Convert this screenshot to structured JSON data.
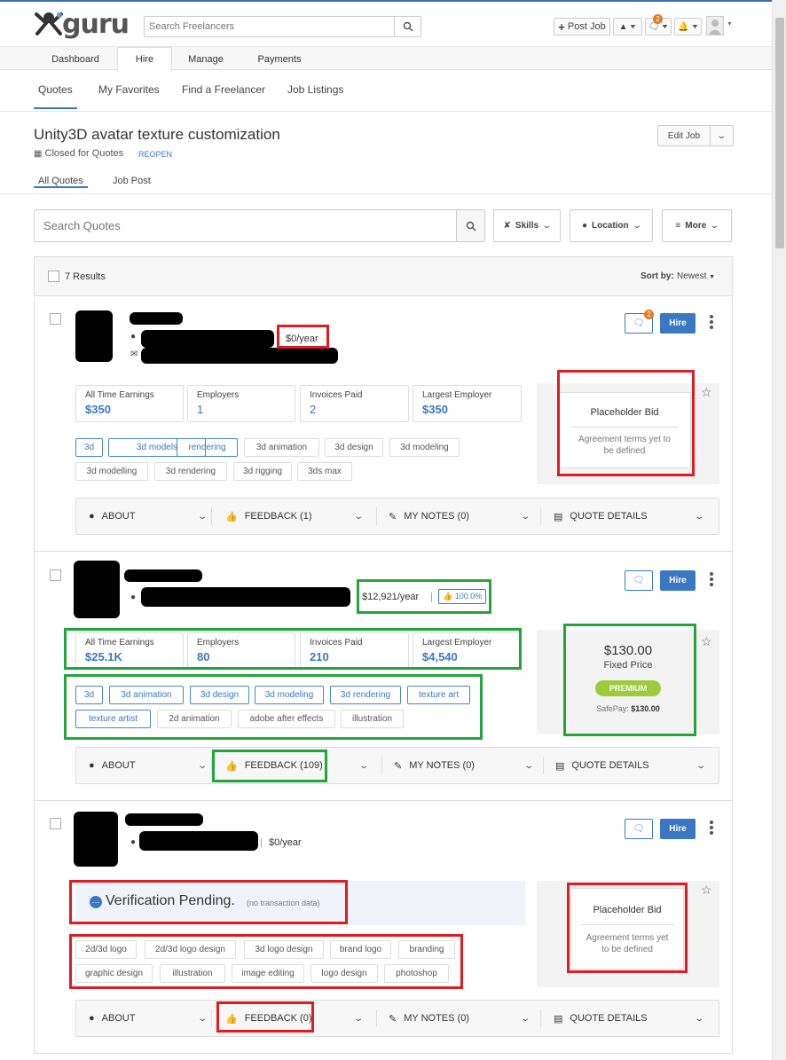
{
  "header": {
    "logo_text": "guru",
    "search_placeholder": "Search Freelancers",
    "post_job_label": "Post Job",
    "messages_badge": "2"
  },
  "main_nav": {
    "tabs": [
      {
        "label": "Dashboard"
      },
      {
        "label": "Hire",
        "active": true
      },
      {
        "label": "Manage"
      },
      {
        "label": "Payments"
      }
    ]
  },
  "sub_nav": {
    "items": [
      {
        "label": "Quotes",
        "active": true
      },
      {
        "label": "My Favorites"
      },
      {
        "label": "Find a Freelancer"
      },
      {
        "label": "Job Listings"
      }
    ]
  },
  "job": {
    "title": "Unity3D avatar texture customization",
    "status": "Closed for Quotes",
    "reopen_label": "REOPEN",
    "edit_label": "Edit Job"
  },
  "quote_tabs": [
    {
      "label": "All Quotes",
      "active": true
    },
    {
      "label": "Job Post"
    }
  ],
  "filters": {
    "search_placeholder": "Search Quotes",
    "skills_label": "Skills",
    "location_label": "Location",
    "more_label": "More"
  },
  "results": {
    "count_label": "7 Results",
    "sort_prefix": "Sort by:",
    "sort_value": "Newest"
  },
  "labels": {
    "hire": "Hire",
    "about": "ABOUT",
    "my_notes": "MY NOTES (0)",
    "quote_details": "QUOTE DETAILS",
    "stat_all_time": "All Time Earnings",
    "stat_employers": "Employers",
    "stat_invoices": "Invoices Paid",
    "stat_largest": "Largest Employer"
  },
  "quotes": [
    {
      "rate": "$0/year",
      "message_badge": "2",
      "stats": {
        "all_time": "$350",
        "employers": "1",
        "invoices": "2",
        "largest": "$350"
      },
      "tags_blue": [
        "3d",
        "3d models",
        "rendering"
      ],
      "tags": [
        "3d animation",
        "3d design",
        "3d modeling",
        "3d modelling",
        "3d rendering",
        "3d rigging",
        "3ds max"
      ],
      "bid_title": "Placeholder Bid",
      "bid_note": "Agreement terms yet to be defined",
      "feedback": "FEEDBACK (1)"
    },
    {
      "rate": "$12,921/year",
      "rating": "100.0%",
      "stats": {
        "all_time": "$25.1K",
        "employers": "80",
        "invoices": "210",
        "largest": "$4,540"
      },
      "tags_blue": [
        "3d",
        "3d animation",
        "3d design",
        "3d modeling",
        "3d rendering",
        "texture art",
        "texture artist"
      ],
      "tags": [
        "2d animation",
        "adobe after effects",
        "illustration"
      ],
      "bid_price": "$130.00",
      "bid_type": "Fixed Price",
      "bid_badge": "PREMIUM",
      "safepay_label": "SafePay:",
      "safepay_value": "$130.00",
      "feedback": "FEEDBACK (109)"
    },
    {
      "rate": "$0/year",
      "verification": "Verification Pending.",
      "verification_note": "(no transaction data)",
      "tags": [
        "2d/3d logo",
        "2d/3d logo design",
        "3d logo design",
        "brand logo",
        "branding",
        "graphic design",
        "illustration",
        "image editing",
        "logo design",
        "photoshop"
      ],
      "bid_title": "Placeholder Bid",
      "bid_note": "Agreement terms yet to be defined",
      "feedback": "FEEDBACK (0)"
    }
  ],
  "colors": {
    "accent": "#3a78c3",
    "highlight_red": "#e11b22",
    "highlight_green": "#22a63c",
    "premium": "#9ccc3c",
    "badge": "#e57c1f"
  }
}
